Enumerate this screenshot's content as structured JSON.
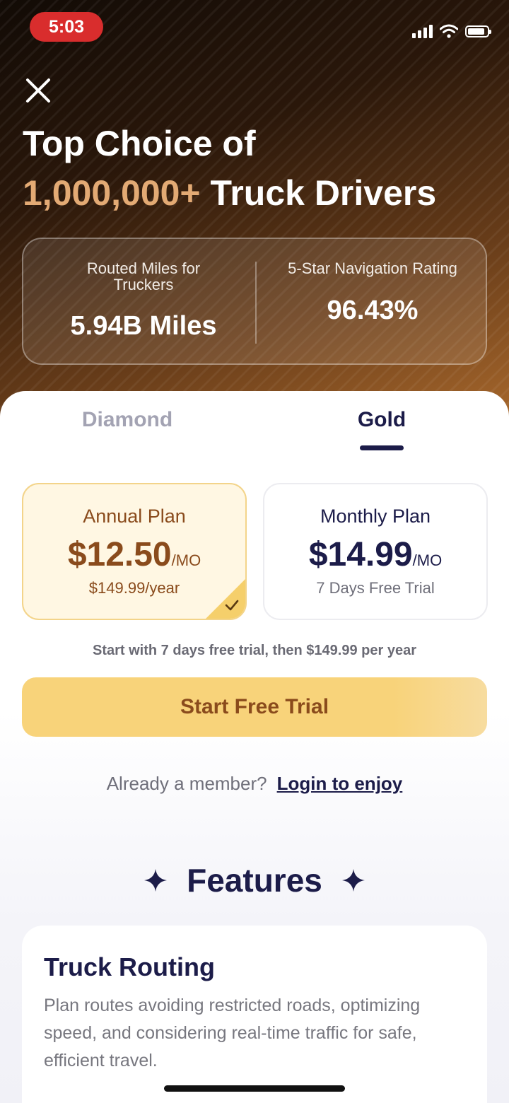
{
  "status_bar": {
    "time": "5:03"
  },
  "hero": {
    "headline_line1": "Top Choice of",
    "headline_accent": "1,000,000+",
    "headline_line2_rest": " Truck Drivers",
    "stats": [
      {
        "label": "Routed Miles for Truckers",
        "value": "5.94B Miles"
      },
      {
        "label": "5-Star Navigation Rating",
        "value": "96.43%"
      }
    ]
  },
  "tabs": [
    {
      "label": "Diamond",
      "active": false
    },
    {
      "label": "Gold",
      "active": true
    }
  ],
  "plans": [
    {
      "title": "Annual Plan",
      "price": "$12.50",
      "unit": "/MO",
      "sub": "$149.99/year",
      "selected": true
    },
    {
      "title": "Monthly Plan",
      "price": "$14.99",
      "unit": "/MO",
      "sub": "7 Days Free Trial",
      "selected": false
    }
  ],
  "trial_note": "Start with 7 days free trial, then $149.99 per year",
  "cta_label": "Start Free Trial",
  "member": {
    "prompt": "Already a member?",
    "link": "Login to enjoy"
  },
  "features": {
    "heading": "Features",
    "cards": [
      {
        "title": "Truck Routing",
        "description": "Plan routes avoiding restricted roads, optimizing speed, and considering real-time traffic for safe, efficient travel."
      }
    ]
  },
  "colors": {
    "accent_gold": "#f8d37a",
    "brown_text": "#8a4b1c",
    "navy_text": "#1c1c49",
    "status_pill": "#d92d2d",
    "headline_accent": "#e3aa74"
  },
  "icons": [
    "close-icon",
    "signal-icon",
    "wifi-icon",
    "battery-icon",
    "check-icon",
    "sparkle-icon"
  ]
}
